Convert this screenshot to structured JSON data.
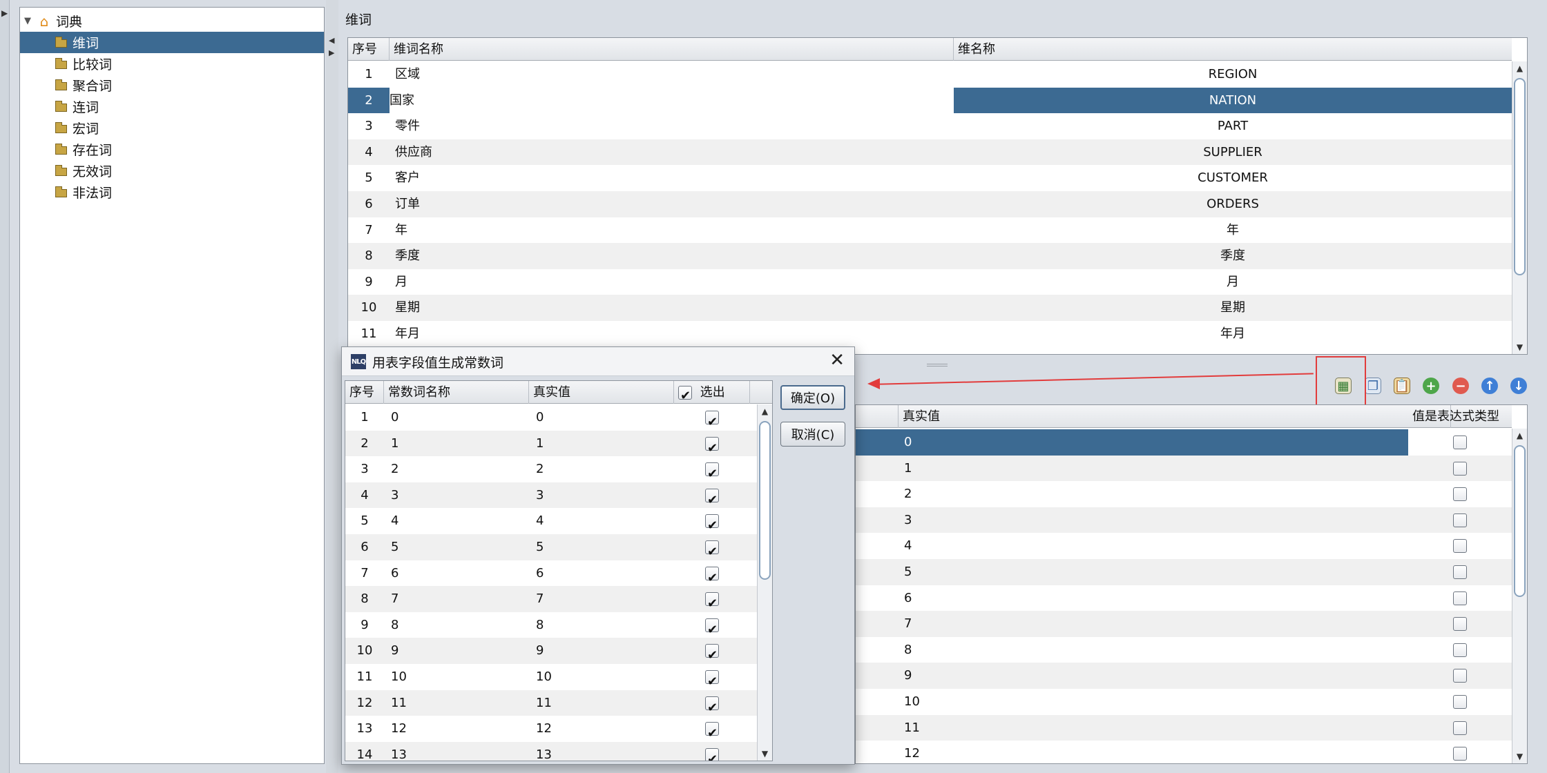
{
  "tree": {
    "root": "词典",
    "items": [
      {
        "label": "维词",
        "selected": true
      },
      {
        "label": "比较词"
      },
      {
        "label": "聚合词"
      },
      {
        "label": "连词"
      },
      {
        "label": "宏词"
      },
      {
        "label": "存在词"
      },
      {
        "label": "无效词"
      },
      {
        "label": "非法词"
      }
    ]
  },
  "main": {
    "title": "维词",
    "columns": [
      "序号",
      "维词名称",
      "维名称"
    ],
    "rows": [
      {
        "no": "1",
        "name": "区域",
        "dim": "REGION"
      },
      {
        "no": "2",
        "name": "国家",
        "dim": "NATION"
      },
      {
        "no": "3",
        "name": "零件",
        "dim": "PART"
      },
      {
        "no": "4",
        "name": "供应商",
        "dim": "SUPPLIER"
      },
      {
        "no": "5",
        "name": "客户",
        "dim": "CUSTOMER"
      },
      {
        "no": "6",
        "name": "订单",
        "dim": "ORDERS"
      },
      {
        "no": "7",
        "name": "年",
        "dim": "年"
      },
      {
        "no": "8",
        "name": "季度",
        "dim": "季度"
      },
      {
        "no": "9",
        "name": "月",
        "dim": "月"
      },
      {
        "no": "10",
        "name": "星期",
        "dim": "星期"
      },
      {
        "no": "11",
        "name": "年月",
        "dim": "年月"
      }
    ]
  },
  "lower": {
    "columns": [
      "真实值",
      "值是表达式类型"
    ],
    "values": [
      "0",
      "1",
      "2",
      "3",
      "4",
      "5",
      "6",
      "7",
      "8",
      "9",
      "10",
      "11",
      "12"
    ]
  },
  "toolbar": {
    "icons": [
      "generate-from-table-icon",
      "copy-icon",
      "paste-icon",
      "add-icon",
      "remove-icon",
      "move-up-icon",
      "move-down-icon"
    ]
  },
  "dialog": {
    "title": "用表字段值生成常数词",
    "app_icon": "NLQ",
    "columns": [
      "序号",
      "常数词名称",
      "真实值",
      "选出"
    ],
    "rows": [
      {
        "no": "1",
        "name": "0",
        "value": "0"
      },
      {
        "no": "2",
        "name": "1",
        "value": "1"
      },
      {
        "no": "3",
        "name": "2",
        "value": "2"
      },
      {
        "no": "4",
        "name": "3",
        "value": "3"
      },
      {
        "no": "5",
        "name": "4",
        "value": "4"
      },
      {
        "no": "6",
        "name": "5",
        "value": "5"
      },
      {
        "no": "7",
        "name": "6",
        "value": "6"
      },
      {
        "no": "8",
        "name": "7",
        "value": "7"
      },
      {
        "no": "9",
        "name": "8",
        "value": "8"
      },
      {
        "no": "10",
        "name": "9",
        "value": "9"
      },
      {
        "no": "11",
        "name": "10",
        "value": "10"
      },
      {
        "no": "12",
        "name": "11",
        "value": "11"
      },
      {
        "no": "13",
        "name": "12",
        "value": "12"
      },
      {
        "no": "14",
        "name": "13",
        "value": "13"
      }
    ],
    "ok_label": "确定(O)",
    "cancel_label": "取消(C)"
  },
  "colors": {
    "selection": "#3c6a92",
    "annotation": "#e23b3b"
  }
}
